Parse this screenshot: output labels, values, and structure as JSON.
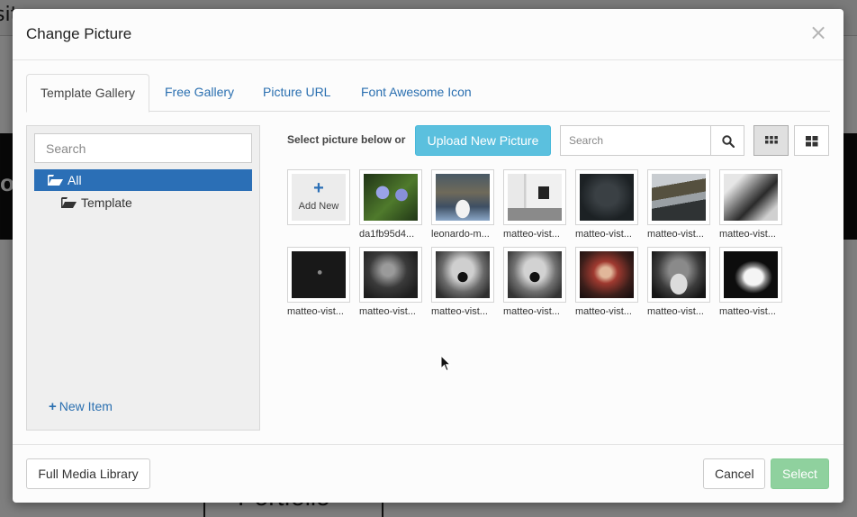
{
  "modal": {
    "title": "Change Picture",
    "close_glyph": "×"
  },
  "tabs": [
    {
      "label": "Template Gallery",
      "active": true
    },
    {
      "label": "Free Gallery",
      "active": false
    },
    {
      "label": "Picture URL",
      "active": false
    },
    {
      "label": "Font Awesome Icon",
      "active": false
    }
  ],
  "tree": {
    "search_placeholder": "Search",
    "items": [
      {
        "label": "All",
        "selected": true
      },
      {
        "label": "Template",
        "selected": false
      }
    ],
    "new_item_label": "New Item"
  },
  "toolbar": {
    "hint": "Select picture below or",
    "upload_label": "Upload New Picture",
    "search_placeholder": "Search"
  },
  "gallery": {
    "add_new_label": "Add New",
    "pictures": [
      {
        "name": "da1fb95d4..."
      },
      {
        "name": "leonardo-m..."
      },
      {
        "name": "matteo-vist..."
      },
      {
        "name": "matteo-vist..."
      },
      {
        "name": "matteo-vist..."
      },
      {
        "name": "matteo-vist..."
      },
      {
        "name": "matteo-vist..."
      },
      {
        "name": "matteo-vist..."
      },
      {
        "name": "matteo-vist..."
      },
      {
        "name": "matteo-vist..."
      },
      {
        "name": "matteo-vist..."
      },
      {
        "name": "matteo-vist..."
      },
      {
        "name": "matteo-vist..."
      },
      {
        "name": "matteo-vist..."
      }
    ]
  },
  "footer": {
    "media_library_label": "Full Media Library",
    "cancel_label": "Cancel",
    "select_label": "Select"
  },
  "background": {
    "top_text": "sito",
    "band_text": "ol",
    "box_text": "Portfolio"
  },
  "colors": {
    "accent": "#2b6fb6",
    "upload": "#5bc0de",
    "select_disabled": "#8fd19e"
  }
}
